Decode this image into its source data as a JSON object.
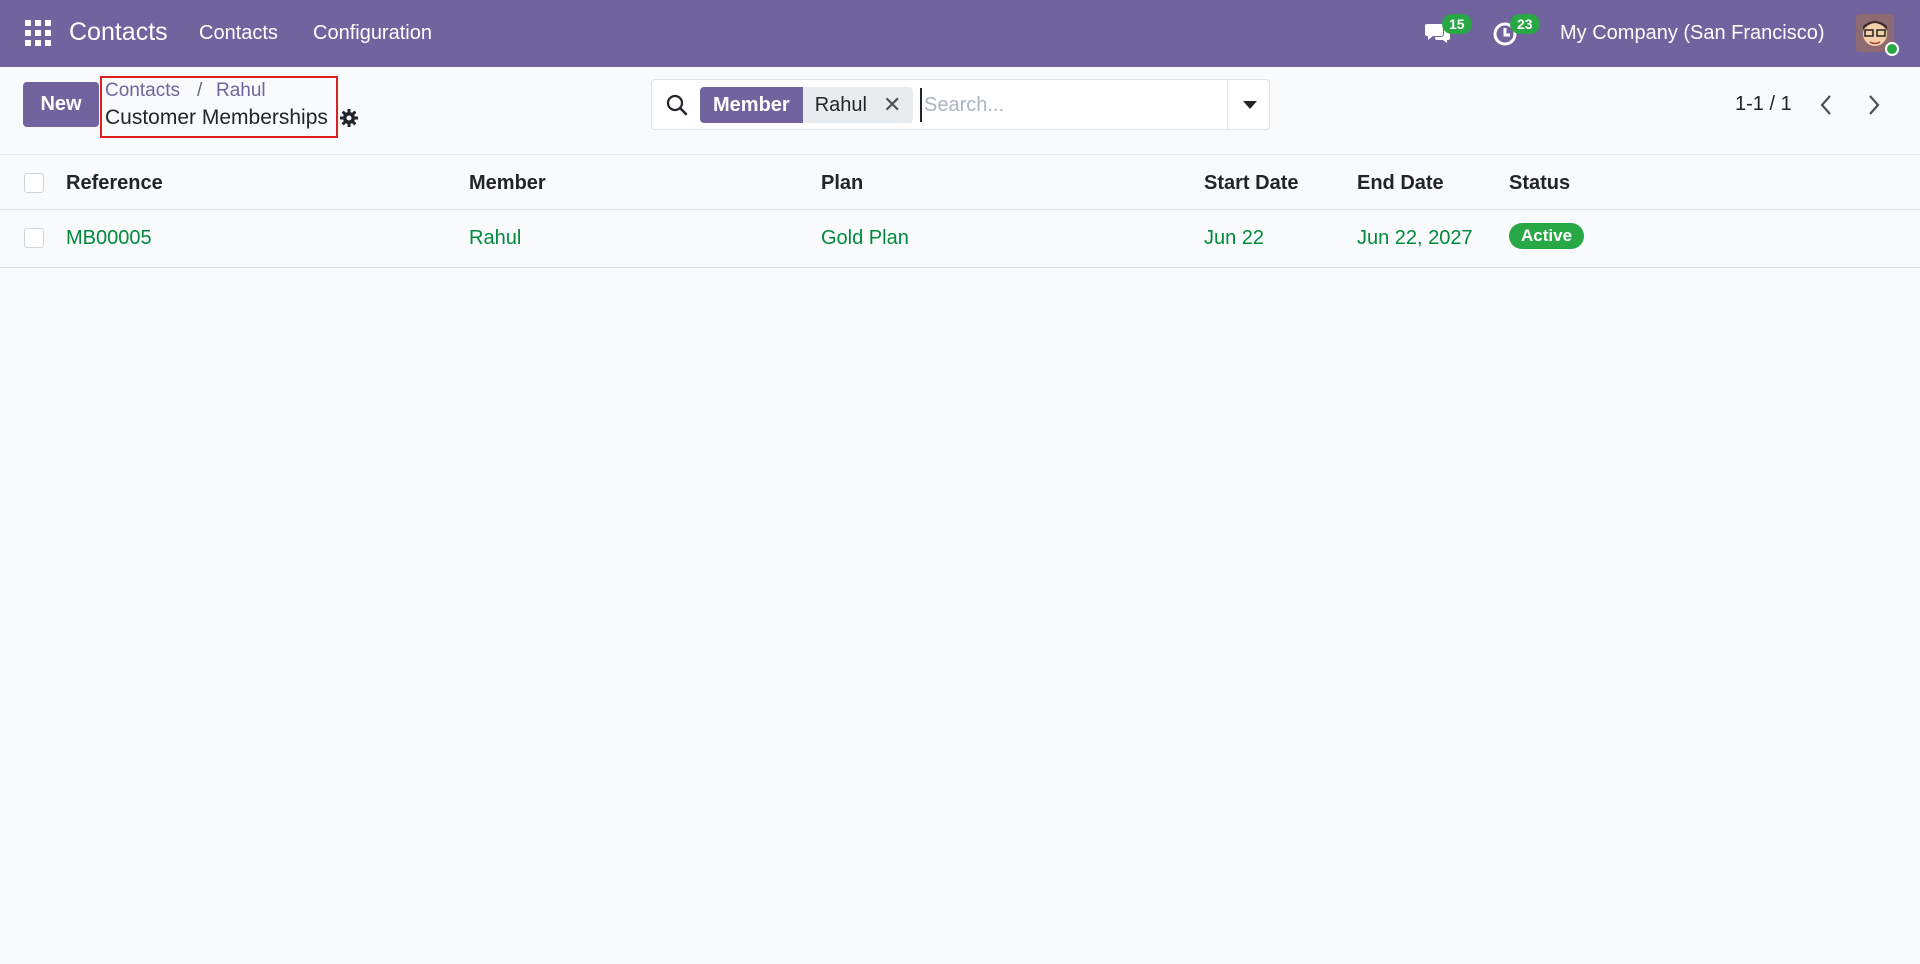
{
  "navbar": {
    "app_name": "Contacts",
    "menu": [
      "Contacts",
      "Configuration"
    ],
    "messages_count": "15",
    "activities_count": "23",
    "company": "My Company (San Francisco)"
  },
  "control_panel": {
    "new_label": "New",
    "breadcrumb": [
      "Contacts",
      "Rahul"
    ],
    "breadcrumb_separator": "/",
    "current": "Customer Memberships"
  },
  "search": {
    "facet_label": "Member",
    "facet_value": "Rahul",
    "placeholder": "Search..."
  },
  "pager": {
    "value": "1-1 / 1"
  },
  "table": {
    "columns": [
      "Reference",
      "Member",
      "Plan",
      "Start Date",
      "End Date",
      "Status"
    ],
    "rows": [
      {
        "reference": "MB00005",
        "member": "Rahul",
        "plan": "Gold Plan",
        "start_date": "Jun 22",
        "end_date": "Jun 22, 2027",
        "status": "Active"
      }
    ]
  },
  "colors": {
    "brand": "#71639e",
    "link_green": "#018a3c",
    "status_green": "#28a745",
    "highlight_red": "#e02020"
  },
  "icons": [
    "apps-grid-icon",
    "chat-icon",
    "clock-icon",
    "gear-icon",
    "search-icon",
    "chevron-left-icon",
    "chevron-right-icon"
  ]
}
